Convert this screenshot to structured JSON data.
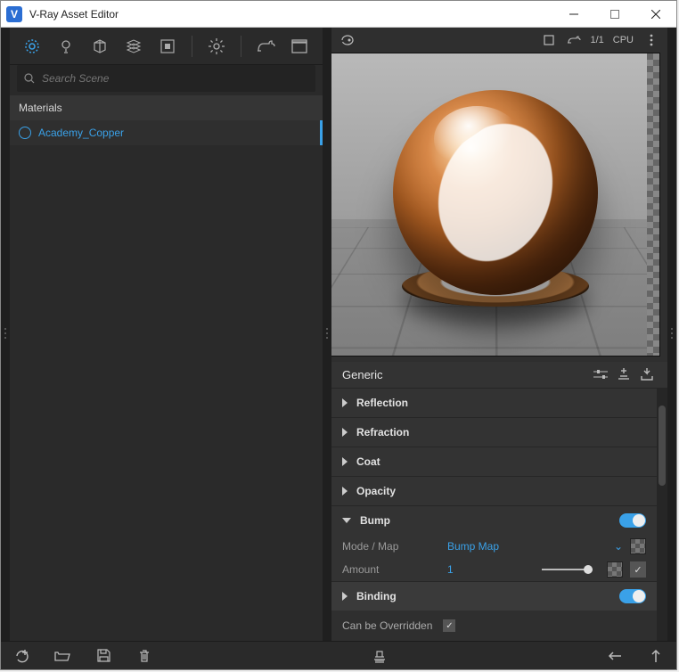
{
  "window": {
    "title": "V-Ray Asset Editor"
  },
  "left": {
    "search_placeholder": "Search Scene",
    "category": "Materials",
    "items": [
      "Academy_Copper"
    ]
  },
  "preview": {
    "count": "1/1",
    "device": "CPU"
  },
  "right": {
    "header": "Generic",
    "sections": [
      {
        "label": "Reflection",
        "expanded": false
      },
      {
        "label": "Refraction",
        "expanded": false
      },
      {
        "label": "Coat",
        "expanded": false
      },
      {
        "label": "Opacity",
        "expanded": false
      },
      {
        "label": "Bump",
        "expanded": true,
        "toggle": true
      },
      {
        "label": "Binding",
        "expanded": false,
        "toggle": true
      }
    ],
    "bump": {
      "mode_label": "Mode / Map",
      "mode_value": "Bump Map",
      "amount_label": "Amount",
      "amount_value": "1"
    },
    "override_label": "Can be Overridden",
    "override_checked": true
  },
  "colors": {
    "accent": "#3aa1e8",
    "panel": "#2a2a2a",
    "panel_light": "#333333"
  }
}
